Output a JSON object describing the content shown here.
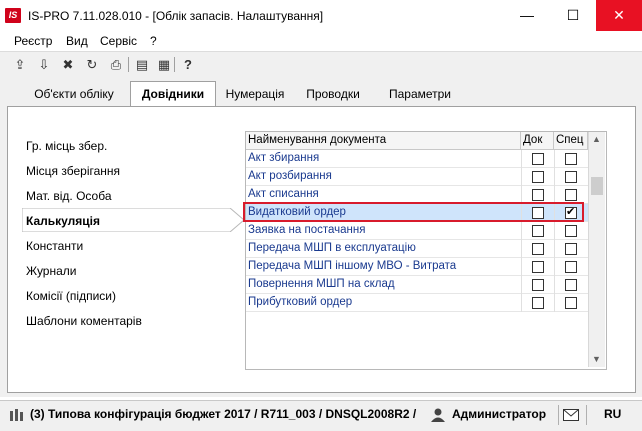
{
  "window": {
    "app_logo": "IS",
    "title": "IS-PRO 7.11.028.010 - [Облік запасів. Налаштування]",
    "minimize": "—",
    "maximize": "☐",
    "close": "✕"
  },
  "menu": [
    "Реєстр",
    "Вид",
    "Сервіс",
    "?"
  ],
  "toolbar": {
    "icons": [
      "export-icon",
      "import-icon",
      "delete-icon",
      "refresh-icon",
      "print-icon",
      "document-icon",
      "settings-icon",
      "help-icon"
    ],
    "glyphs": [
      "⇪",
      "⇩",
      "✖",
      "↻",
      "⎙",
      "▤",
      "▦",
      "?"
    ]
  },
  "tabs": [
    {
      "label": "Об'єкти обліку",
      "active": false
    },
    {
      "label": "Довідники",
      "active": true
    },
    {
      "label": "Нумерація",
      "active": false
    },
    {
      "label": "Проводки",
      "active": false
    },
    {
      "label": "Параметри",
      "active": false
    }
  ],
  "left_menu": [
    {
      "label": "Гр. місць збер.",
      "active": false
    },
    {
      "label": "Місця зберігання",
      "active": false
    },
    {
      "label": "Мат. від. Особа",
      "active": false
    },
    {
      "label": "Калькуляція",
      "active": true
    },
    {
      "label": "Константи",
      "active": false
    },
    {
      "label": "Журнали",
      "active": false
    },
    {
      "label": "Комісії (підписи)",
      "active": false
    },
    {
      "label": "Шаблони коментарів",
      "active": false
    }
  ],
  "grid": {
    "columns": [
      "Найменування документа",
      "Док",
      "Спец"
    ],
    "rows": [
      {
        "name": "Акт збирання",
        "dok": false,
        "spec": false,
        "selected": false
      },
      {
        "name": "Акт розбирання",
        "dok": false,
        "spec": false,
        "selected": false
      },
      {
        "name": "Акт списання",
        "dok": false,
        "spec": false,
        "selected": false
      },
      {
        "name": "Видатковий ордер",
        "dok": false,
        "spec": true,
        "selected": true
      },
      {
        "name": "Заявка на постачання",
        "dok": false,
        "spec": false,
        "selected": false
      },
      {
        "name": "Передача МШП в експлуатацію",
        "dok": false,
        "spec": false,
        "selected": false
      },
      {
        "name": "Передача МШП іншому МВО - Витрата",
        "dok": false,
        "spec": false,
        "selected": false
      },
      {
        "name": "Повернення МШП на склад",
        "dok": false,
        "spec": false,
        "selected": false
      },
      {
        "name": "Прибутковий ордер",
        "dok": false,
        "spec": false,
        "selected": false
      }
    ]
  },
  "status": {
    "config": "(3) Типова конфігурація бюджет 2017 / R711_003 / DNSQL2008R2 /",
    "user": "Администратор",
    "lang": "RU"
  },
  "colors": {
    "accent_red": "#d81b2c",
    "link_blue": "#1a3a8f",
    "selection": "#cfe4fb"
  }
}
